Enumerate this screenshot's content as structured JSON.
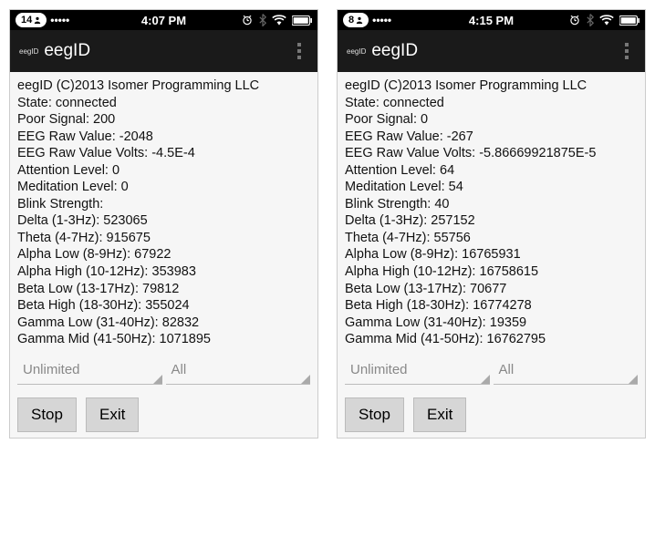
{
  "screens": [
    {
      "status": {
        "badge": "14",
        "time": "4:07 PM"
      },
      "app": {
        "logo": "eegID",
        "title": "eegID"
      },
      "copyright": "eegID (C)2013 Isomer Programming LLC",
      "fields": {
        "state_label": "State:",
        "state_value": "connected",
        "poor_signal_label": "Poor Signal:",
        "poor_signal_value": "200",
        "raw_label": "EEG Raw Value:",
        "raw_value": "-2048",
        "raw_volts_label": "EEG Raw Value Volts:",
        "raw_volts_value": "-4.5E-4",
        "attention_label": "Attention Level:",
        "attention_value": "0",
        "meditation_label": "Meditation Level:",
        "meditation_value": "0",
        "blink_label": "Blink Strength:",
        "blink_value": "",
        "delta_label": "Delta (1-3Hz):",
        "delta_value": "523065",
        "theta_label": "Theta (4-7Hz):",
        "theta_value": "915675",
        "alpha_low_label": "Alpha Low (8-9Hz):",
        "alpha_low_value": "67922",
        "alpha_high_label": "Alpha High (10-12Hz):",
        "alpha_high_value": "353983",
        "beta_low_label": "Beta Low (13-17Hz):",
        "beta_low_value": "79812",
        "beta_high_label": "Beta High (18-30Hz):",
        "beta_high_value": "355024",
        "gamma_low_label": "Gamma Low (31-40Hz):",
        "gamma_low_value": "82832",
        "gamma_mid_label": "Gamma Mid (41-50Hz):",
        "gamma_mid_value": "1071895"
      },
      "spinner1": "Unlimited",
      "spinner2": "All",
      "stop": "Stop",
      "exit": "Exit"
    },
    {
      "status": {
        "badge": "8",
        "time": "4:15 PM"
      },
      "app": {
        "logo": "eegID",
        "title": "eegID"
      },
      "copyright": "eegID (C)2013 Isomer Programming LLC",
      "fields": {
        "state_label": "State:",
        "state_value": "connected",
        "poor_signal_label": "Poor Signal:",
        "poor_signal_value": "0",
        "raw_label": "EEG Raw Value:",
        "raw_value": "-267",
        "raw_volts_label": "EEG Raw Value Volts:",
        "raw_volts_value": "-5.86669921875E-5",
        "attention_label": "Attention Level:",
        "attention_value": "64",
        "meditation_label": "Meditation Level:",
        "meditation_value": "54",
        "blink_label": "Blink Strength:",
        "blink_value": "40",
        "delta_label": "Delta (1-3Hz):",
        "delta_value": "257152",
        "theta_label": "Theta (4-7Hz):",
        "theta_value": "55756",
        "alpha_low_label": "Alpha Low (8-9Hz):",
        "alpha_low_value": "16765931",
        "alpha_high_label": "Alpha High (10-12Hz):",
        "alpha_high_value": "16758615",
        "beta_low_label": "Beta Low (13-17Hz):",
        "beta_low_value": "70677",
        "beta_high_label": "Beta High (18-30Hz):",
        "beta_high_value": "16774278",
        "gamma_low_label": "Gamma Low (31-40Hz):",
        "gamma_low_value": "19359",
        "gamma_mid_label": "Gamma Mid (41-50Hz):",
        "gamma_mid_value": "16762795"
      },
      "spinner1": "Unlimited",
      "spinner2": "All",
      "stop": "Stop",
      "exit": "Exit"
    }
  ]
}
